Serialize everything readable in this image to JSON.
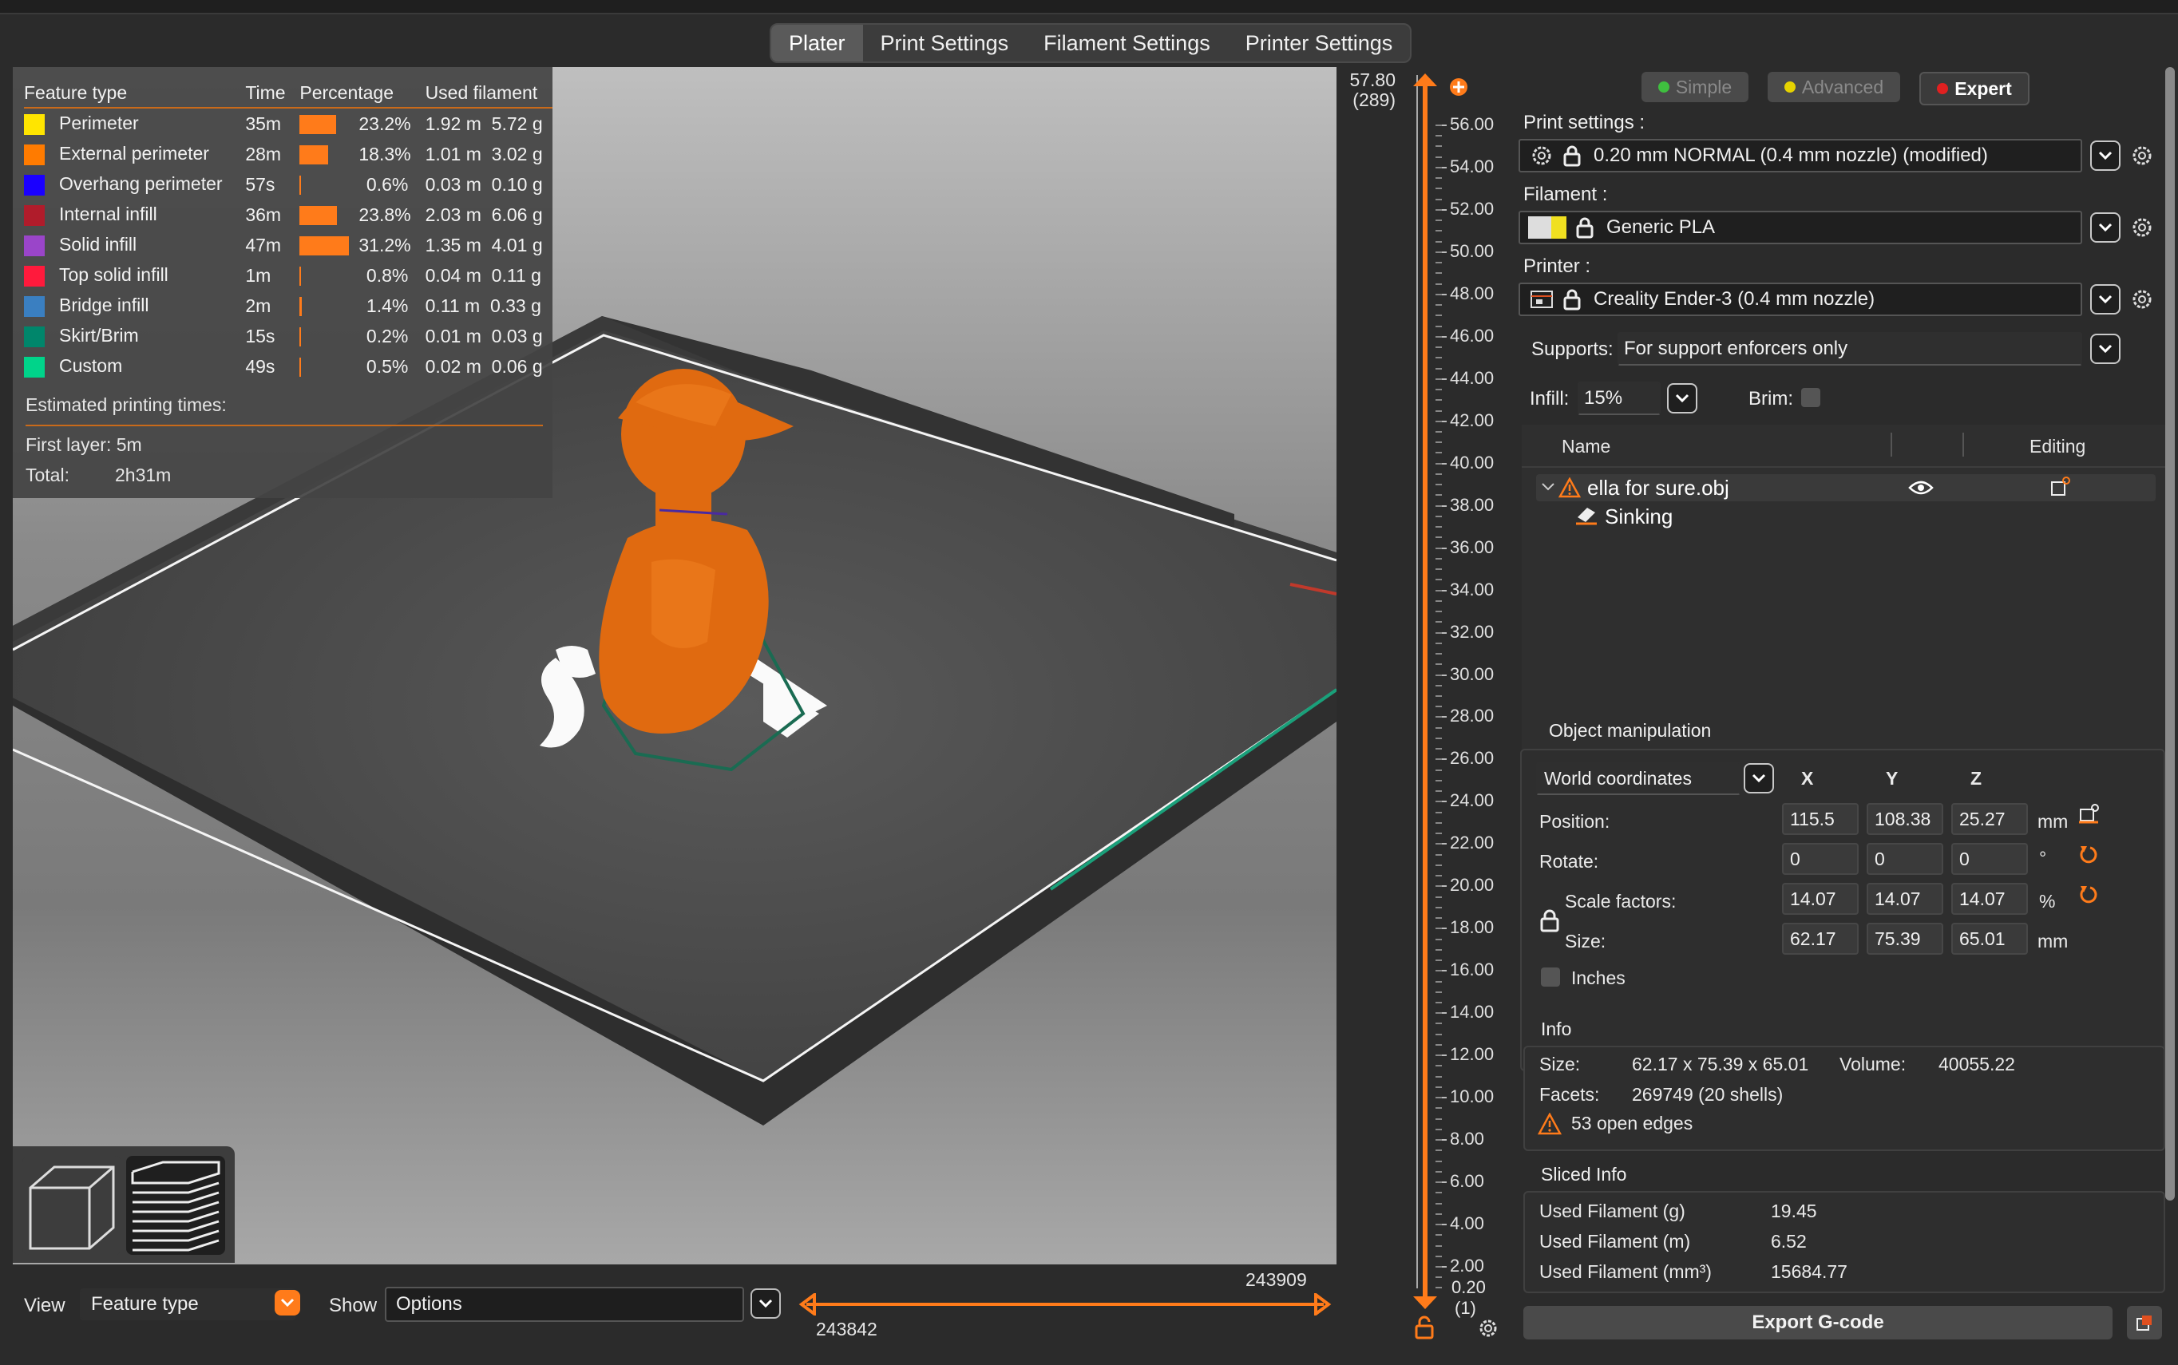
{
  "tabs": [
    "Plater",
    "Print Settings",
    "Filament Settings",
    "Printer Settings"
  ],
  "active_tab": "Plater",
  "legend": {
    "headers": [
      "Feature type",
      "Time",
      "Percentage",
      "Used filament"
    ],
    "rows": [
      {
        "name": "Perimeter",
        "color": "#ffe500",
        "time": "35m",
        "pct": "23.2%",
        "pct_value": 23.2,
        "len": "1.92 m",
        "weight": "5.72 g"
      },
      {
        "name": "External perimeter",
        "color": "#ff7b00",
        "time": "28m",
        "pct": "18.3%",
        "pct_value": 18.3,
        "len": "1.01 m",
        "weight": "3.02 g"
      },
      {
        "name": "Overhang perimeter",
        "color": "#1a00ff",
        "time": "57s",
        "pct": "0.6%",
        "pct_value": 0.6,
        "len": "0.03 m",
        "weight": "0.10 g"
      },
      {
        "name": "Internal infill",
        "color": "#b01c2b",
        "time": "36m",
        "pct": "23.8%",
        "pct_value": 23.8,
        "len": "2.03 m",
        "weight": "6.06 g"
      },
      {
        "name": "Solid infill",
        "color": "#9a45c9",
        "time": "47m",
        "pct": "31.2%",
        "pct_value": 31.2,
        "len": "1.35 m",
        "weight": "4.01 g"
      },
      {
        "name": "Top solid infill",
        "color": "#ff1a3c",
        "time": "1m",
        "pct": "0.8%",
        "pct_value": 0.8,
        "len": "0.04 m",
        "weight": "0.11 g"
      },
      {
        "name": "Bridge infill",
        "color": "#3a7fc1",
        "time": "2m",
        "pct": "1.4%",
        "pct_value": 1.4,
        "len": "0.11 m",
        "weight": "0.33 g"
      },
      {
        "name": "Skirt/Brim",
        "color": "#00866b",
        "time": "15s",
        "pct": "0.2%",
        "pct_value": 0.2,
        "len": "0.01 m",
        "weight": "0.03 g"
      },
      {
        "name": "Custom",
        "color": "#00d48a",
        "time": "49s",
        "pct": "0.5%",
        "pct_value": 0.5,
        "len": "0.02 m",
        "weight": "0.06 g"
      }
    ],
    "estimated_title": "Estimated printing times:",
    "first_layer": "First layer: 5m",
    "total_label": "Total:",
    "total_value": "2h31m"
  },
  "bottom": {
    "view_label": "View",
    "view_value": "Feature type",
    "show_label": "Show",
    "show_value": "Options",
    "range_top": "243909",
    "range_bottom": "243842",
    "range_fill_fraction": 1.0
  },
  "vslider": {
    "top_value": "57.80",
    "top_layer": "(289)",
    "bottom_value": "0.20",
    "bottom_layer": "(1)",
    "ticks": [
      "56.00",
      "54.00",
      "52.00",
      "50.00",
      "48.00",
      "46.00",
      "44.00",
      "42.00",
      "40.00",
      "38.00",
      "36.00",
      "34.00",
      "32.00",
      "30.00",
      "28.00",
      "26.00",
      "24.00",
      "22.00",
      "20.00",
      "18.00",
      "16.00",
      "14.00",
      "12.00",
      "10.00",
      "8.00",
      "6.00",
      "4.00",
      "2.00"
    ]
  },
  "panel": {
    "modes": [
      {
        "label": "Simple",
        "color": "#3fbf3f",
        "active": false
      },
      {
        "label": "Advanced",
        "color": "#e6d200",
        "active": false
      },
      {
        "label": "Expert",
        "color": "#e02020",
        "active": true
      }
    ],
    "print_settings_label": "Print settings :",
    "print_settings_value": "0.20 mm NORMAL (0.4 mm nozzle) (modified)",
    "filament_label": "Filament :",
    "filament_value": "Generic PLA",
    "filament_color": "#f0e020",
    "printer_label": "Printer :",
    "printer_value": "Creality Ender-3 (0.4 mm nozzle)",
    "supports_label": "Supports:",
    "supports_value": "For support enforcers only",
    "infill_label": "Infill:",
    "infill_value": "15%",
    "brim_label": "Brim:",
    "list_headers": [
      "Name",
      "Editing"
    ],
    "object_name": "ella for sure.obj",
    "object_child": "Sinking",
    "manip_title": "Object manipulation",
    "coord_value": "World coordinates",
    "axes": [
      "X",
      "Y",
      "Z"
    ],
    "position_label": "Position:",
    "position": [
      "115.5",
      "108.38",
      "25.27"
    ],
    "position_unit": "mm",
    "rotate_label": "Rotate:",
    "rotate": [
      "0",
      "0",
      "0"
    ],
    "rotate_unit": "°",
    "scale_label": "Scale factors:",
    "scale": [
      "14.07",
      "14.07",
      "14.07"
    ],
    "scale_unit": "%",
    "size_label": "Size:",
    "size": [
      "62.17",
      "75.39",
      "65.01"
    ],
    "size_unit": "mm",
    "inches_label": "Inches",
    "info_title": "Info",
    "info_size_label": "Size:",
    "info_size_value": "62.17 x 75.39 x 65.01",
    "info_volume_label": "Volume:",
    "info_volume_value": "40055.22",
    "info_facets_label": "Facets:",
    "info_facets_value": "269749 (20 shells)",
    "info_warning": "53 open edges",
    "sliced_title": "Sliced Info",
    "sliced_rows": [
      {
        "label": "Used Filament (g)",
        "value": "19.45"
      },
      {
        "label": "Used Filament (m)",
        "value": "6.52"
      },
      {
        "label": "Used Filament (mm³)",
        "value": "15684.77"
      }
    ],
    "export_label": "Export G-code"
  },
  "accent_color": "#ff7b1a"
}
